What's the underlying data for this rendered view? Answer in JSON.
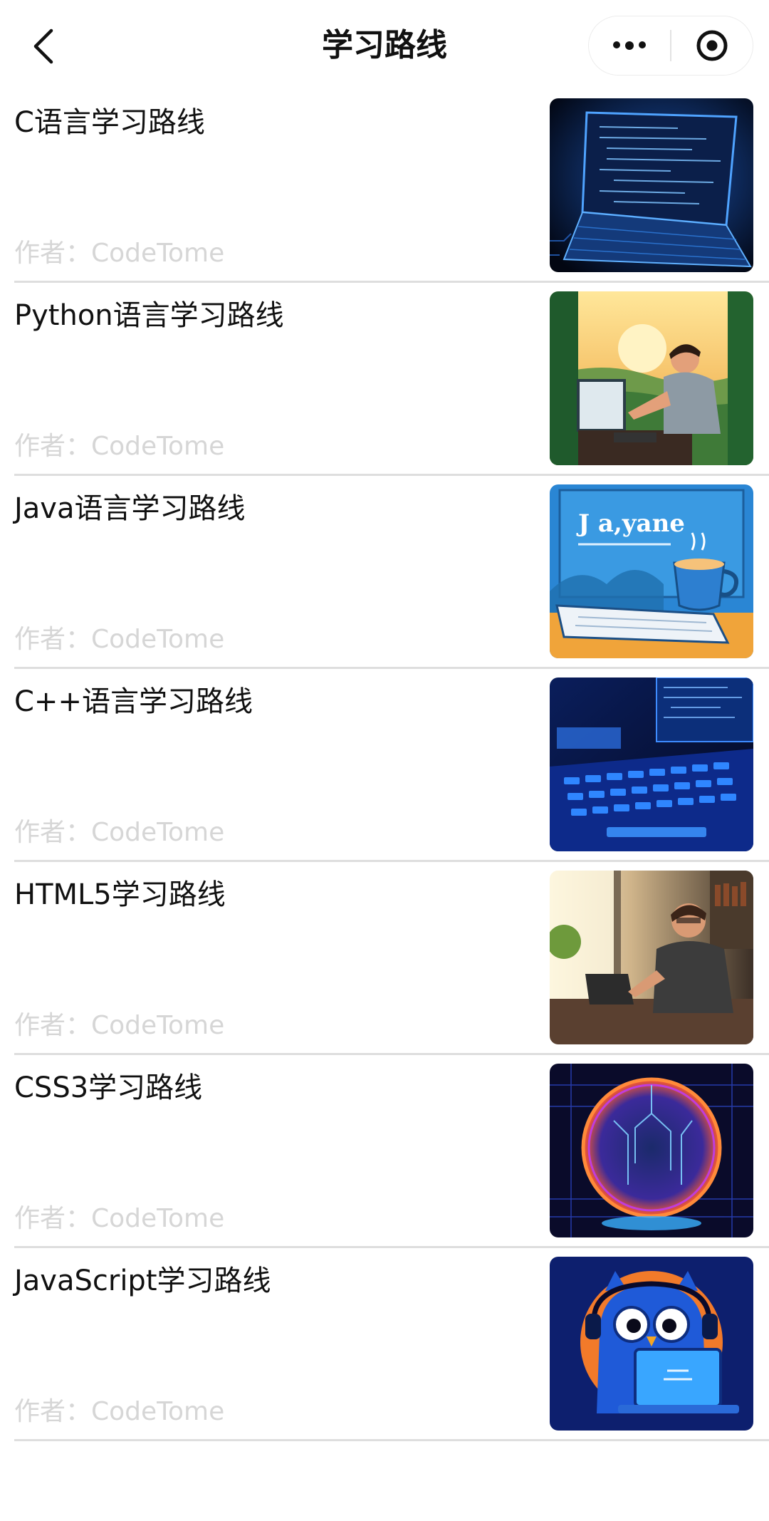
{
  "nav": {
    "title": "学习路线",
    "back_icon": "chevron-left-icon",
    "more_icon": "more-dots-icon",
    "close_icon": "target-close-icon"
  },
  "items": [
    {
      "title": "C语言学习路线",
      "author": "作者：CodeTome",
      "image": "laptop-code-dark-blue"
    },
    {
      "title": "Python语言学习路线",
      "author": "作者：CodeTome",
      "image": "man-coding-jungle-sunset"
    },
    {
      "title": "Java语言学习路线",
      "author": "作者：CodeTome",
      "image": "java-coffee-cup-monitor",
      "image_text": "J a,yane"
    },
    {
      "title": "C++语言学习路线",
      "author": "作者：CodeTome",
      "image": "neon-blue-keyboard"
    },
    {
      "title": "HTML5学习路线",
      "author": "作者：CodeTome",
      "image": "man-laptop-sunlit-room"
    },
    {
      "title": "CSS3学习路线",
      "author": "作者：CodeTome",
      "image": "neon-circuit-globe"
    },
    {
      "title": "JavaScript学习路线",
      "author": "作者：CodeTome",
      "image": "owl-headphones-laptop"
    }
  ]
}
